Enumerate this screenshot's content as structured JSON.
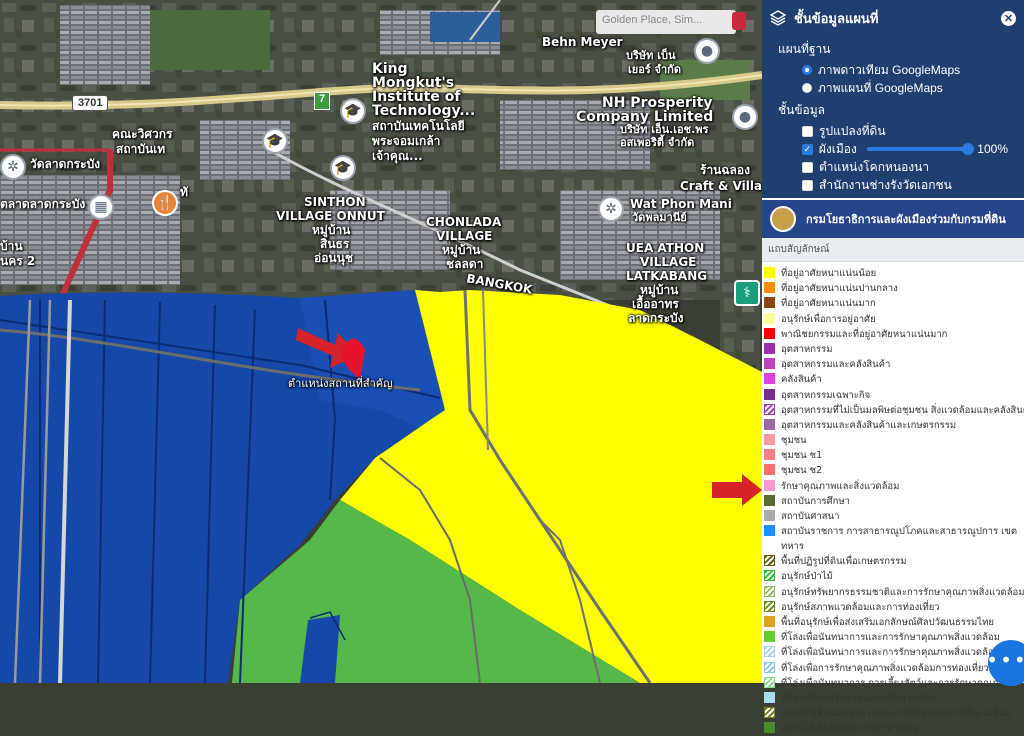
{
  "map": {
    "road_shield_3701": "3701",
    "route_marker": "7",
    "labels": {
      "behn_meyer": "Behn Meyer",
      "behn_meyer_th": "บริษัท เบ็น",
      "behn_meyer_th2": "เยอร์ จำกัด",
      "kmitl_1": "King",
      "kmitl_2": "Mongkut's",
      "kmitl_3": "Institute of",
      "kmitl_4": "Technology...",
      "kmitl_th_1": "สถาบันเทคโนโลยี",
      "kmitl_th_2": "พระจอมเกล้า",
      "kmitl_th_3": "เจ้าคุณ...",
      "nh_1": "NH Prosperity",
      "nh_2": "Company Limited",
      "nh_th_1": "บริษัท เอ็น.เอช.พร",
      "nh_th_2": "อสเพอริตี้ จำกัด",
      "faculty_1": "คณะวิศวกร",
      "faculty_2": "สถาบันเท",
      "wat_lad_krabang": "วัดลาดกระบัง",
      "lad_krabang_market": "ตลาดลาดกระบัง",
      "ban": "บ้าน",
      "nakhon2": "นคร 2",
      "sinthon_1": "SINTHON",
      "sinthon_2": "VILLAGE ONNUT",
      "sinthon_th_1": "หมู่บ้าน",
      "sinthon_th_2": "สินธร",
      "sinthon_th_3": "อ่อนนุช",
      "chonlada_1": "CHONLADA",
      "chonlada_2": "VILLAGE",
      "chonlada_th_1": "หมู่บ้าน",
      "chonlada_th_2": "ชลลดา",
      "craft_1": "ร้านฉลอง",
      "craft_2": "Craft & Villa",
      "wat_phon_mani": "Wat Phon Mani",
      "wat_phon_mani_th": "วัดพลมานีย์",
      "uea_1": "UEA ATHON",
      "uea_2": "VILLAGE",
      "uea_3": "LATKABANG",
      "uea_th_1": "หมู่บ้าน",
      "uea_th_2": "เอื้ออาทร",
      "uea_th_3": "ลาดกระบัง",
      "bangkok": "BANGKOK",
      "ta": "ทั",
      "location_label": "ตำแหน่งสถานที่สำคัญ"
    },
    "search_placeholder": "Golden Place, Sim..."
  },
  "panel": {
    "title": "ชั้นข้อมูลแผนที่",
    "close_icon": "close-icon",
    "basemap_heading": "แผนที่ฐาน",
    "basemaps": [
      {
        "label": "ภาพดาวเทียม GoogleMaps",
        "selected": true
      },
      {
        "label": "ภาพแผนที่ GoogleMaps",
        "selected": false
      }
    ],
    "layers_heading": "ชั้นข้อมูล",
    "layers": [
      {
        "label": "รูปแปลงที่ดิน",
        "checked": false
      },
      {
        "label": "ผังเมือง",
        "checked": true,
        "opacity": "100%"
      },
      {
        "label": "ตำแหน่งโคกหนองนา",
        "checked": false
      },
      {
        "label": "สำนักงานช่างรังวัดเอกชน",
        "checked": false
      }
    ],
    "banner": "กรมโยธาธิการและผังเมืองร่วมกับกรมที่ดิน",
    "legend_heading": "แถบสัญลักษณ์",
    "legend": [
      {
        "label": "ที่อยู่อาศัยหนาแน่นน้อย",
        "color": "#ffff00"
      },
      {
        "label": "ที่อยู่อาศัยหนาแน่นปานกลาง",
        "color": "#ff8c00"
      },
      {
        "label": "ที่อยู่อาศัยหนาแน่นมาก",
        "color": "#8b4513"
      },
      {
        "label": "อนุรักษ์เพื่อการอยู่อาศัย",
        "color": "#ffff99"
      },
      {
        "label": "พาณิชยกรรมและที่อยู่อาศัยหนาแน่นมาก",
        "color": "#ff0000"
      },
      {
        "label": "อุตสาหกรรม",
        "color": "#9b30b0"
      },
      {
        "label": "อุตสาหกรรมและคลังสินค้า",
        "color": "#c040c0"
      },
      {
        "label": "คลังสินค้า",
        "color": "#e040e0"
      },
      {
        "label": "อุตสาหกรรมเฉพาะกิจ",
        "color": "#7a2a8a"
      },
      {
        "label": "อุตสาหกรรมที่ไม่เป็นมลพิษต่อชุมชน สิ่งแวดล้อมและคลังสินค้า",
        "color": "#a040b0",
        "hatch": true
      },
      {
        "label": "อุตสาหกรรมและคลังสินค้าและเกษตรกรรม",
        "color": "#9a6aa0"
      },
      {
        "label": "ชุมชน",
        "color": "#ff9999"
      },
      {
        "label": "ชุมชน ช1",
        "color": "#ff8080"
      },
      {
        "label": "ชุมชน ช2",
        "color": "#ff6f6f"
      },
      {
        "label": "รักษาคุณภาพและสิ่งแวดล้อม",
        "color": "#ff99cc"
      },
      {
        "label": "สถาบันการศึกษา",
        "color": "#556b2f"
      },
      {
        "label": "สถาบันศาสนา",
        "color": "#aaaaaa"
      },
      {
        "label": "สถาบันราชการ การสาธารณูปโภคและสาธารณูปการ เขตทหาร",
        "color": "#1e90ff",
        "wrap": true
      },
      {
        "label": "พื้นที่ปฏิรูปที่ดินเพื่อเกษตรกรรม",
        "color": "#6b5a1a",
        "hatch": true
      },
      {
        "label": "อนุรักษ์ป่าไม้",
        "color": "#33bb33",
        "hatch": true
      },
      {
        "label": "อนุรักษ์ทรัพยากรธรรมชาติและการรักษาคุณภาพสิ่งแวดล้อม",
        "color": "#99bb66",
        "hatch": true
      },
      {
        "label": "อนุรักษ์สภาพแวดล้อมและการท่องเที่ยว",
        "color": "#6b8e23",
        "hatch": true
      },
      {
        "label": "พื้นที่อนุรักษ์เพื่อส่งเสริมเอกลักษณ์ศิลปวัฒนธรรมไทย",
        "color": "#e0a020"
      },
      {
        "label": "ที่โล่งเพื่อนันทนาการและการรักษาคุณภาพสิ่งแวดล้อม",
        "color": "#66cc33"
      },
      {
        "label": "ที่โล่งเพื่อนันทนาการและการรักษาคุณภาพสิ่งแวดล้อมชายฝั่งทะเล",
        "color": "#aad4ee",
        "hatch": true
      },
      {
        "label": "ที่โล่งเพื่อการรักษาคุณภาพสิ่งแวดล้อมการท่องเที่ยวและการประมง",
        "color": "#88ccdd",
        "hatch": true
      },
      {
        "label": "ที่โล่งเพื่อนันทนาการ การเลี้ยงสัตว์และการรักษาคุณภาพสิ่งแวดล้อม",
        "color": "#88dd88",
        "hatch": true
      },
      {
        "label": "ที่โล่งเพื่อการรักษาคุณภาพสิ่งแวดล้อม",
        "color": "#aaddee"
      },
      {
        "label": "สงวนไว้เพื่อนันทนาการและการรักษาคุณภาพสิ่งแวดล้อม",
        "color": "#7a7a20",
        "hatch": true
      },
      {
        "label": "สงวนไว้เพื่อรักษาสภาพป่าชายเลน",
        "color": "#4a8a2a"
      }
    ]
  }
}
